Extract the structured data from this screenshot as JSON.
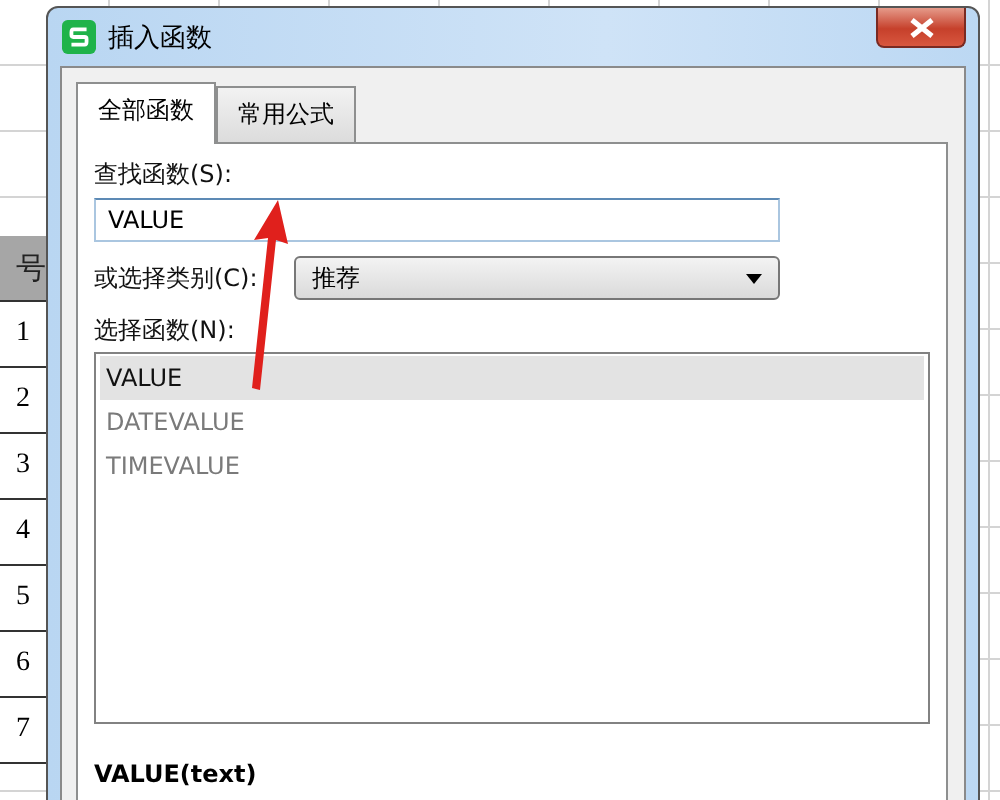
{
  "sheet": {
    "header": "号",
    "rows": [
      "1",
      "2",
      "3",
      "4",
      "5",
      "6",
      "7"
    ]
  },
  "window": {
    "title": "插入函数"
  },
  "tabs": [
    {
      "label": "全部函数",
      "selected": true
    },
    {
      "label": "常用公式",
      "selected": false
    }
  ],
  "search": {
    "label": "查找函数(S):",
    "value": "VALUE"
  },
  "category": {
    "label": "或选择类别(C):",
    "value": "推荐"
  },
  "functions": {
    "label": "选择函数(N):",
    "items": [
      {
        "name": "VALUE",
        "selected": true
      },
      {
        "name": "DATEVALUE",
        "selected": false
      },
      {
        "name": "TIMEVALUE",
        "selected": false
      }
    ]
  },
  "signature": "VALUE(text)"
}
